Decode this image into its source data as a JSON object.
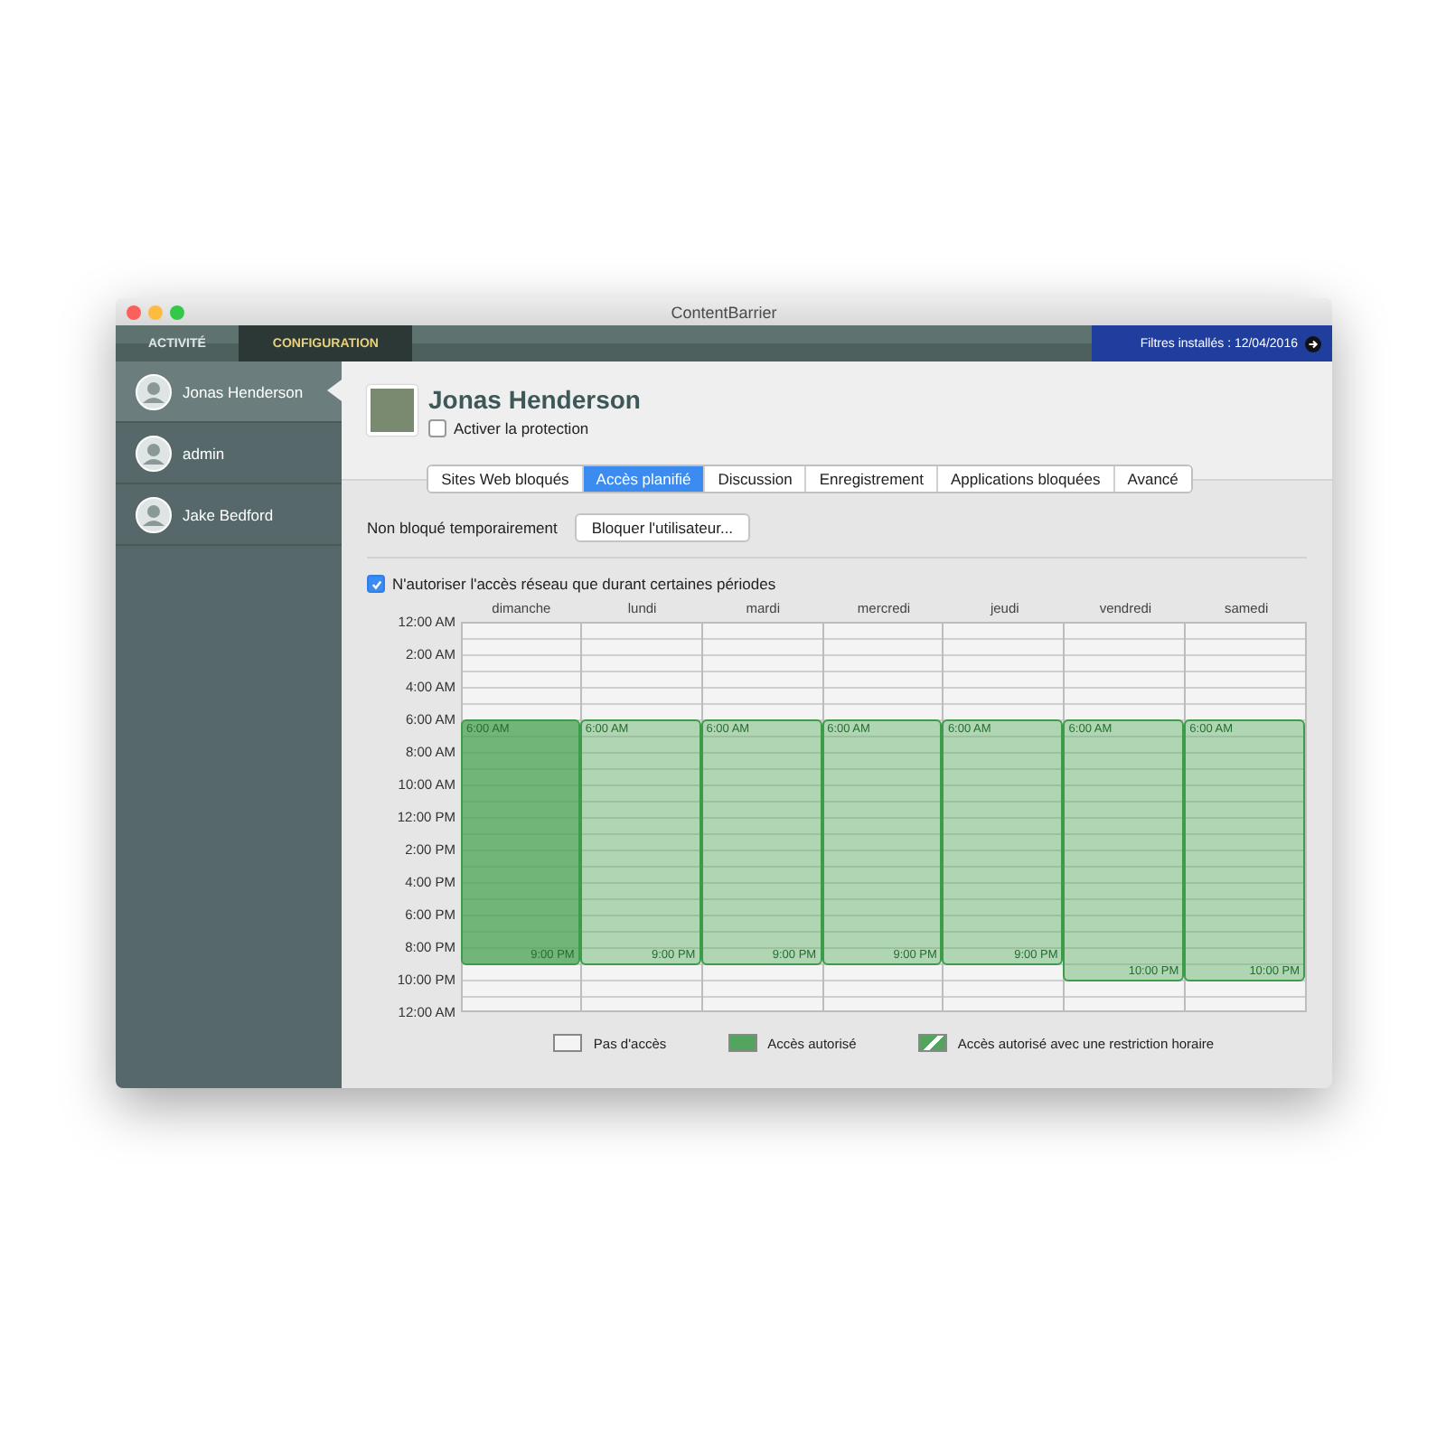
{
  "window": {
    "title": "ContentBarrier"
  },
  "top_tabs": [
    {
      "label": "ACTIVITÉ",
      "selected": false
    },
    {
      "label": "CONFIGURATION",
      "selected": true
    }
  ],
  "filters_status": "Filtres installés : 12/04/2016",
  "sidebar": {
    "users": [
      {
        "name": "Jonas Henderson",
        "selected": true
      },
      {
        "name": "admin",
        "selected": false
      },
      {
        "name": "Jake Bedford",
        "selected": false
      }
    ]
  },
  "profile": {
    "name": "Jonas Henderson",
    "protection": {
      "label": "Activer la protection",
      "checked": false
    }
  },
  "tabs": [
    {
      "label": "Sites Web bloqués",
      "selected": false
    },
    {
      "label": "Accès planifié",
      "selected": true
    },
    {
      "label": "Discussion",
      "selected": false
    },
    {
      "label": "Enregistrement",
      "selected": false
    },
    {
      "label": "Applications bloquées",
      "selected": false
    },
    {
      "label": "Avancé",
      "selected": false
    }
  ],
  "temp_block": {
    "label": "Non bloqué temporairement",
    "button": "Bloquer l'utilisateur..."
  },
  "schedule": {
    "checkbox": {
      "label": "N'autoriser l'accès réseau que durant certaines périodes",
      "checked": true
    },
    "time_labels": [
      "12:00 AM",
      "2:00 AM",
      "4:00 AM",
      "6:00 AM",
      "8:00 AM",
      "10:00 AM",
      "12:00 PM",
      "2:00 PM",
      "4:00 PM",
      "6:00 PM",
      "8:00 PM",
      "10:00 PM",
      "12:00 AM"
    ],
    "days": [
      {
        "name": "dimanche",
        "selected": true,
        "blocks": [
          {
            "start": "6:00 AM",
            "end": "9:00 PM"
          }
        ]
      },
      {
        "name": "lundi",
        "selected": false,
        "blocks": [
          {
            "start": "6:00 AM",
            "end": "9:00 PM"
          }
        ]
      },
      {
        "name": "mardi",
        "selected": false,
        "blocks": [
          {
            "start": "6:00 AM",
            "end": "9:00 PM"
          }
        ]
      },
      {
        "name": "mercredi",
        "selected": false,
        "blocks": [
          {
            "start": "6:00 AM",
            "end": "9:00 PM"
          }
        ]
      },
      {
        "name": "jeudi",
        "selected": false,
        "blocks": [
          {
            "start": "6:00 AM",
            "end": "9:00 PM"
          }
        ]
      },
      {
        "name": "vendredi",
        "selected": false,
        "blocks": [
          {
            "start": "6:00 AM",
            "end": "10:00 PM"
          }
        ]
      },
      {
        "name": "samedi",
        "selected": false,
        "blocks": [
          {
            "start": "6:00 AM",
            "end": "10:00 PM"
          }
        ]
      }
    ]
  },
  "legend": [
    {
      "kind": "none",
      "label": "Pas d'accès"
    },
    {
      "kind": "allowed",
      "label": "Accès autorisé"
    },
    {
      "kind": "restricted",
      "label": "Accès autorisé avec une restriction horaire"
    }
  ]
}
